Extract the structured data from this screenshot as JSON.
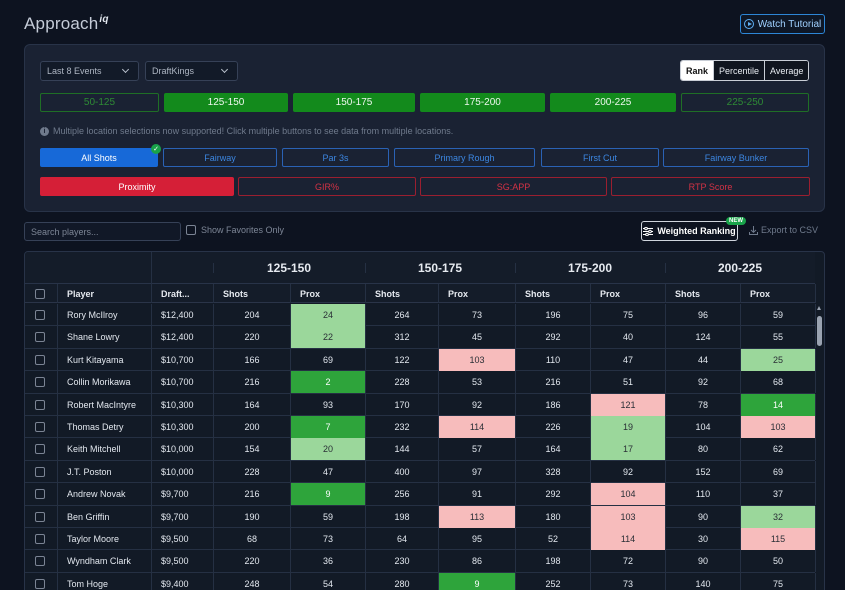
{
  "app": {
    "logo_text": "Approach",
    "logo_suffix": "iq",
    "tutorial_label": "Watch Tutorial"
  },
  "filters": {
    "events": "Last 8 Events",
    "site": "DraftKings",
    "view_modes": [
      {
        "label": "Rank",
        "active": true
      },
      {
        "label": "Percentile",
        "active": false
      },
      {
        "label": "Average",
        "active": false
      }
    ],
    "ranges": [
      {
        "label": "50-125",
        "active": false
      },
      {
        "label": "125-150",
        "active": true
      },
      {
        "label": "150-175",
        "active": true
      },
      {
        "label": "175-200",
        "active": true
      },
      {
        "label": "200-225",
        "active": true
      },
      {
        "label": "225-250",
        "active": false
      }
    ],
    "info_text": "Multiple location selections now supported! Click multiple buttons to see data from multiple locations.",
    "locations": [
      {
        "label": "All Shots",
        "active": true
      },
      {
        "label": "Fairway",
        "active": false
      },
      {
        "label": "Par 3s",
        "active": false
      },
      {
        "label": "Primary Rough",
        "active": false
      },
      {
        "label": "First Cut",
        "active": false
      },
      {
        "label": "Fairway Bunker",
        "active": false
      }
    ],
    "metrics": [
      {
        "label": "Proximity",
        "active": true
      },
      {
        "label": "GIR%",
        "active": false
      },
      {
        "label": "SG:APP",
        "active": false
      },
      {
        "label": "RTP Score",
        "active": false
      }
    ]
  },
  "toolbar": {
    "search_placeholder": "Search players...",
    "favorites_label": "Show Favorites Only",
    "weighted_label": "Weighted Ranking",
    "new_badge": "NEW",
    "export_label": "Export to CSV"
  },
  "table": {
    "groups": [
      "125-150",
      "150-175",
      "175-200",
      "200-225"
    ],
    "columns": [
      "Player",
      "Draft...",
      "Shots",
      "Prox",
      "Shots",
      "Prox",
      "Shots",
      "Prox",
      "Shots",
      "Prox"
    ],
    "colors": {
      "green_strong": "#2ea43b",
      "green_light": "#9bd79b",
      "red_light": "#f7bcbc"
    },
    "rows": [
      {
        "player": "Rory McIlroy",
        "salary": "$12,400",
        "v": [
          204,
          24,
          264,
          73,
          196,
          75,
          96,
          59
        ],
        "h": [
          "",
          "gl",
          "",
          "",
          "",
          "",
          "",
          ""
        ]
      },
      {
        "player": "Shane Lowry",
        "salary": "$12,400",
        "v": [
          220,
          22,
          312,
          45,
          292,
          40,
          124,
          55
        ],
        "h": [
          "",
          "gl",
          "",
          "",
          "",
          "",
          "",
          ""
        ]
      },
      {
        "player": "Kurt Kitayama",
        "salary": "$10,700",
        "v": [
          166,
          69,
          122,
          103,
          110,
          47,
          44,
          25
        ],
        "h": [
          "",
          "",
          "",
          "rl",
          "",
          "",
          "",
          "gl"
        ]
      },
      {
        "player": "Collin Morikawa",
        "salary": "$10,700",
        "v": [
          216,
          2,
          228,
          53,
          216,
          51,
          92,
          68
        ],
        "h": [
          "",
          "gs",
          "",
          "",
          "",
          "",
          "",
          ""
        ]
      },
      {
        "player": "Robert MacIntyre",
        "salary": "$10,300",
        "v": [
          164,
          93,
          170,
          92,
          186,
          121,
          78,
          14
        ],
        "h": [
          "",
          "",
          "",
          "",
          "",
          "rl",
          "",
          "gs"
        ]
      },
      {
        "player": "Thomas Detry",
        "salary": "$10,300",
        "v": [
          200,
          7,
          232,
          114,
          226,
          19,
          104,
          103
        ],
        "h": [
          "",
          "gs",
          "",
          "rl",
          "",
          "gl",
          "",
          "rl"
        ]
      },
      {
        "player": "Keith Mitchell",
        "salary": "$10,000",
        "v": [
          154,
          20,
          144,
          57,
          164,
          17,
          80,
          62
        ],
        "h": [
          "",
          "gl",
          "",
          "",
          "",
          "gl",
          "",
          ""
        ]
      },
      {
        "player": "J.T. Poston",
        "salary": "$10,000",
        "v": [
          228,
          47,
          400,
          97,
          328,
          92,
          152,
          69
        ],
        "h": [
          "",
          "",
          "",
          "",
          "",
          "",
          "",
          ""
        ]
      },
      {
        "player": "Andrew Novak",
        "salary": "$9,700",
        "v": [
          216,
          9,
          256,
          91,
          292,
          104,
          110,
          37
        ],
        "h": [
          "",
          "gs",
          "",
          "",
          "",
          "rl",
          "",
          ""
        ]
      },
      {
        "player": "Ben Griffin",
        "salary": "$9,700",
        "v": [
          190,
          59,
          198,
          113,
          180,
          103,
          90,
          32
        ],
        "h": [
          "",
          "",
          "",
          "rl",
          "",
          "rl",
          "",
          "gl"
        ]
      },
      {
        "player": "Taylor Moore",
        "salary": "$9,500",
        "v": [
          68,
          73,
          64,
          95,
          52,
          114,
          30,
          115
        ],
        "h": [
          "",
          "",
          "",
          "",
          "",
          "rl",
          "",
          "rl"
        ]
      },
      {
        "player": "Wyndham Clark",
        "salary": "$9,500",
        "v": [
          220,
          36,
          230,
          86,
          198,
          72,
          90,
          50
        ],
        "h": [
          "",
          "",
          "",
          "",
          "",
          "",
          "",
          ""
        ]
      },
      {
        "player": "Tom Hoge",
        "salary": "$9,400",
        "v": [
          248,
          54,
          280,
          9,
          252,
          73,
          140,
          75
        ],
        "h": [
          "",
          "",
          "",
          "gs",
          "",
          "",
          "",
          ""
        ]
      }
    ]
  }
}
